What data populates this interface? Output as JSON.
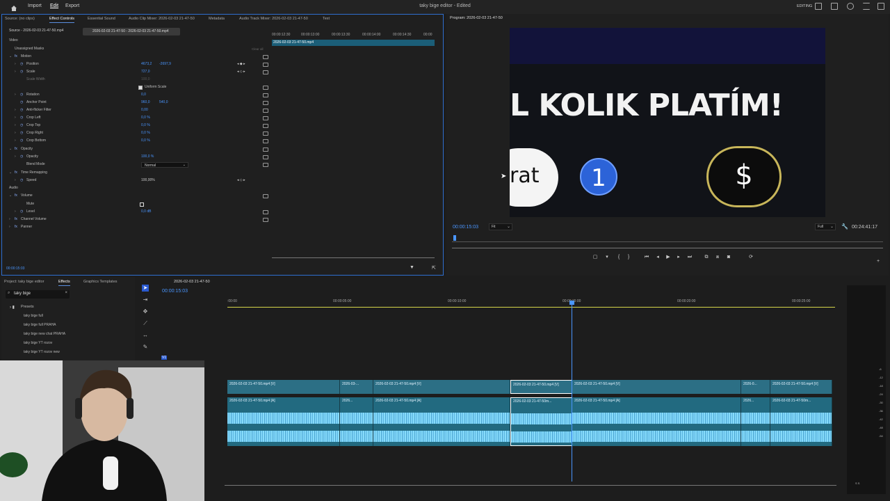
{
  "app": {
    "title": "taky bige editor - Edited",
    "menu": [
      "Import",
      "Edit",
      "Export"
    ],
    "workspace": "EDITING"
  },
  "effect_controls": {
    "tabs": [
      "Source: (no clips)",
      "Effect Controls",
      "Essential Sound",
      "Audio Clip Mixer: 2026-02-03 21-47-50",
      "Metadata",
      "Audio Track Mixer: 2026-02-03 21-47-50",
      "Text"
    ],
    "source": "Source - 2026-02-03 21-47-50.mp4",
    "sequence_clip": "2026-02-03 21-47-50 - 2026-02-03 21-47-50.mp4",
    "ruler": [
      "00:00:12:30",
      "00:00:13:00",
      "00:00:13:30",
      "00:00:14:00",
      "00:00:14:30",
      "00:00"
    ],
    "mini_clip": "2026-02-03 21-47-50.mp4",
    "clear_all": "Clear all",
    "rows": [
      {
        "label": "Video",
        "v1": "",
        "v2": ""
      },
      {
        "label": "Unassigned Masks",
        "v1": "",
        "v2": ""
      },
      {
        "label": "Motion",
        "v1": "",
        "v2": ""
      },
      {
        "label": "Position",
        "v1": "4673,2",
        "v2": "-2697,9"
      },
      {
        "label": "Scale",
        "v1": "727,0",
        "v2": ""
      },
      {
        "label": "Scale Width",
        "v1": "100,0",
        "v2": ""
      },
      {
        "label": "Uniform Scale",
        "v1": "",
        "v2": ""
      },
      {
        "label": "Rotation",
        "v1": "0,0",
        "v2": ""
      },
      {
        "label": "Anchor Point",
        "v1": "960,0",
        "v2": "540,0"
      },
      {
        "label": "Anti-flicker Filter",
        "v1": "0,00",
        "v2": ""
      },
      {
        "label": "Crop Left",
        "v1": "0,0 %",
        "v2": ""
      },
      {
        "label": "Crop Top",
        "v1": "0,0 %",
        "v2": ""
      },
      {
        "label": "Crop Right",
        "v1": "0,0 %",
        "v2": ""
      },
      {
        "label": "Crop Bottom",
        "v1": "0,0 %",
        "v2": ""
      },
      {
        "label": "Opacity",
        "v1": "",
        "v2": ""
      },
      {
        "label": "Opacity",
        "v1": "100,0 %",
        "v2": ""
      },
      {
        "label": "Blend Mode",
        "v1": "Normal",
        "v2": ""
      },
      {
        "label": "Time Remapping",
        "v1": "",
        "v2": ""
      },
      {
        "label": "Speed",
        "v1": "100,00%",
        "v2": ""
      },
      {
        "label": "Audio",
        "v1": "",
        "v2": ""
      },
      {
        "label": "Volume",
        "v1": "",
        "v2": ""
      },
      {
        "label": "Mute",
        "v1": "",
        "v2": ""
      },
      {
        "label": "Level",
        "v1": "0,0 dB",
        "v2": ""
      },
      {
        "label": "Channel Volume",
        "v1": "",
        "v2": ""
      },
      {
        "label": "Panner",
        "v1": "",
        "v2": ""
      }
    ],
    "timecode": "00:00:15:03"
  },
  "program": {
    "title": "Program: 2026-02-03 21-47-50",
    "headline": "L KOLIK PLATÍM!",
    "btn_text": "rat",
    "btn_number": "1",
    "btn_symbol": "$",
    "timecode": "00:00:15:03",
    "fit": "Fit",
    "full": "Full",
    "duration": "00:24:41:17"
  },
  "project": {
    "tabs": [
      "Project: taky bige editor",
      "Effects",
      "Graphics Templates"
    ],
    "search": "taky bige",
    "folder": "Presets",
    "items": [
      "taky bige full",
      "taky bige full PRAHA",
      "taky bige new chat PRAHA",
      "taky bige YT rozov",
      "taky bige YT rozov new"
    ]
  },
  "timeline": {
    "tab": "2026-02-03 21-47-50",
    "timecode": "00:00:15:03",
    "ruler": [
      ":00:00",
      "00:00:05:00",
      "00:00:10:00",
      "00:00:15:00",
      "00:00:20:00",
      "00:00:25:00"
    ],
    "video_clips": [
      "2026-02-03 21-47-50.mp4 [V]",
      "2026-03-...",
      "2026-02-03 21-47-50.mp4 [V]",
      "2026-02-03 21-47-50.mp4 [V]",
      "2026-02-03 21-47-50.mp4 [V]",
      "2026-0...",
      "2026-02-03 21-47-50.mp4 [V]"
    ],
    "audio_clips": [
      "2026-02-03 21-47-50.mp4 [A]",
      "2026...",
      "2026-02-03 21-47-50.mp4 [A]",
      "2026-02-03 21-47-50m...",
      "2026-02-03 21-47-50.mp4 [A]",
      "2026...",
      "2026-02-03 21-47-50m..."
    ],
    "track": "V1"
  },
  "meter": {
    "labels": [
      "-6",
      "-12",
      "-18",
      "-24",
      "-30",
      "-36",
      "-42",
      "-48",
      "-54"
    ],
    "bottom": "S  S"
  }
}
